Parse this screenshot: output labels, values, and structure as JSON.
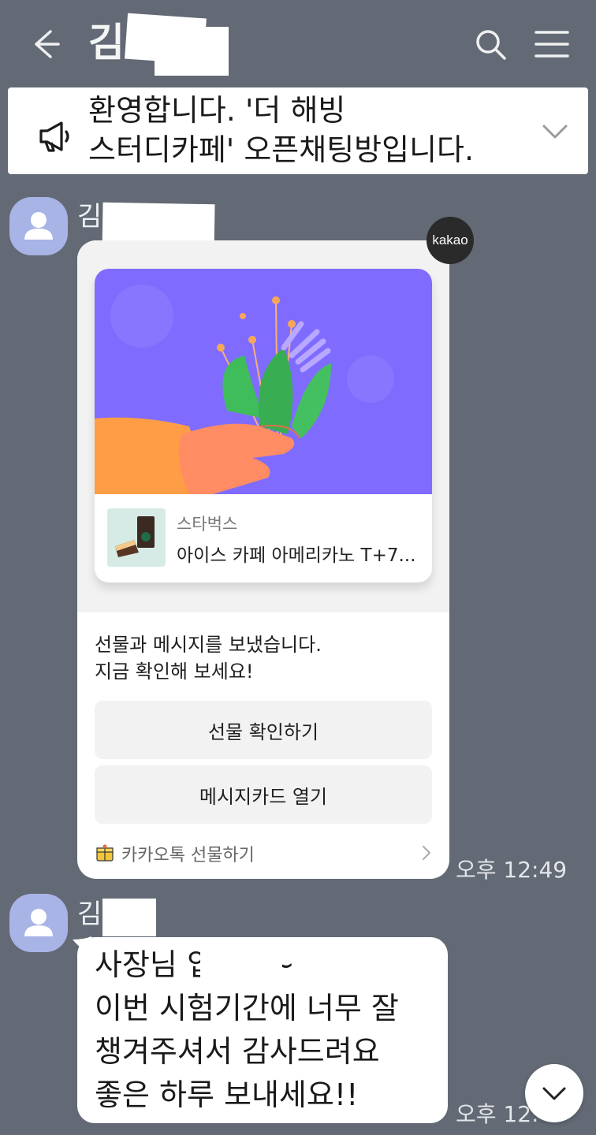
{
  "header": {
    "title": "김",
    "back_icon": "arrow-left-icon",
    "search_icon": "search-icon",
    "menu_icon": "hamburger-menu-icon"
  },
  "notice": {
    "text": "환영합니다. '더 해빙\n스터디카페' 오픈채팅방입니다.",
    "icon": "megaphone-icon",
    "expand_icon": "chevron-down-icon"
  },
  "messages": [
    {
      "sender": "김",
      "badge": "kakao",
      "gift": {
        "brand": "스타벅스",
        "product": "아이스 카페 아메리카노 T+7...",
        "message": "선물과 메시지를 보냈습니다.\n지금 확인해 보세요!",
        "buttons": [
          "선물 확인하기",
          "메시지카드 열기"
        ],
        "footer": "카카오톡 선물하기"
      },
      "time": "오후 12:49"
    },
    {
      "sender": "김",
      "text": "사장님               입니다~\n이번 시험기간에 너무 잘\n챙겨주셔서 감사드려요\n좋은 하루 보내세요!!",
      "time": "오후 12:"
    }
  ],
  "colors": {
    "background": "#636a75",
    "illustration_bg": "#7f6cff",
    "avatar": "#a8b3e6"
  }
}
